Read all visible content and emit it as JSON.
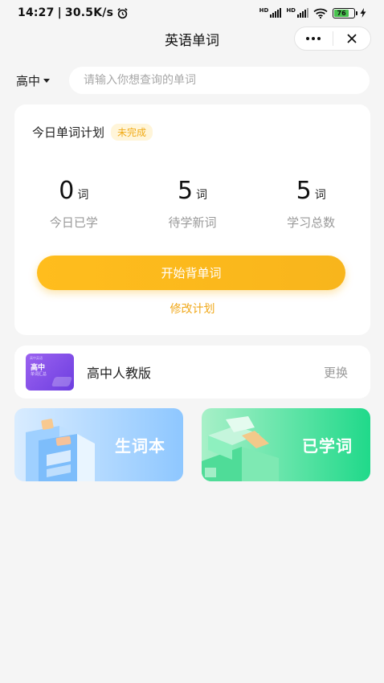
{
  "status": {
    "time": "14:27",
    "speed": "30.5K/s",
    "battery": "76"
  },
  "nav": {
    "title": "英语单词"
  },
  "search": {
    "grade": "高中",
    "placeholder": "请输入你想查询的单词"
  },
  "plan": {
    "title": "今日单词计划",
    "badge": "未完成",
    "stats": [
      {
        "value": "0",
        "unit": "词",
        "label": "今日已学"
      },
      {
        "value": "5",
        "unit": "词",
        "label": "待学新词"
      },
      {
        "value": "5",
        "unit": "词",
        "label": "学习总数"
      }
    ],
    "start_label": "开始背单词",
    "edit_label": "修改计划"
  },
  "book": {
    "cover_tag": "高中英语",
    "cover_title": "高中",
    "cover_subtitle": "单词汇总",
    "name": "高中人教版",
    "change_label": "更换"
  },
  "tiles": {
    "new_words": "生词本",
    "learned_words": "已学词"
  },
  "colors": {
    "accent": "#f8b51c",
    "badge_text": "#f1aa16",
    "new_tile": "#8ec7ff",
    "learned_tile": "#20d98a"
  }
}
